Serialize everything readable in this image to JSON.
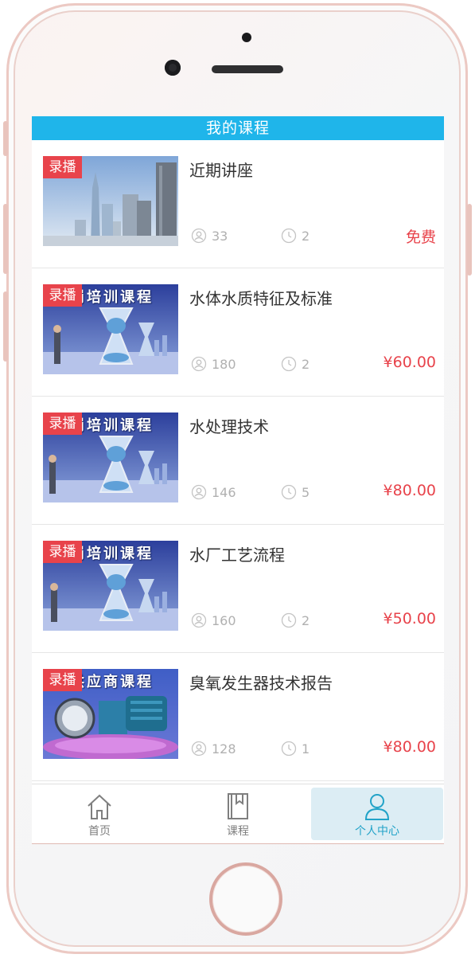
{
  "header": {
    "title": "我的课程"
  },
  "badge_label": "录播",
  "courses": [
    {
      "title": "近期讲座",
      "students": "33",
      "lessons": "2",
      "price": "免费",
      "banner": ""
    },
    {
      "title": "水体水质特征及标准",
      "students": "180",
      "lessons": "2",
      "price": "¥60.00",
      "banner": "岗培训课程"
    },
    {
      "title": "水处理技术",
      "students": "146",
      "lessons": "5",
      "price": "¥80.00",
      "banner": "岗培训课程"
    },
    {
      "title": "水厂工艺流程",
      "students": "160",
      "lessons": "2",
      "price": "¥50.00",
      "banner": "岗培训课程"
    },
    {
      "title": "臭氧发生器技术报告",
      "students": "128",
      "lessons": "1",
      "price": "¥80.00",
      "banner": "供应商课程"
    }
  ],
  "tabbar": {
    "items": [
      {
        "label": "首页",
        "icon": "home-icon"
      },
      {
        "label": "课程",
        "icon": "book-icon"
      },
      {
        "label": "个人中心",
        "icon": "user-icon",
        "active": true
      }
    ]
  },
  "colors": {
    "accent": "#1fb5ea",
    "price": "#e8434b",
    "badge": "#e8434b",
    "active_tab_bg": "#dcedf4"
  }
}
